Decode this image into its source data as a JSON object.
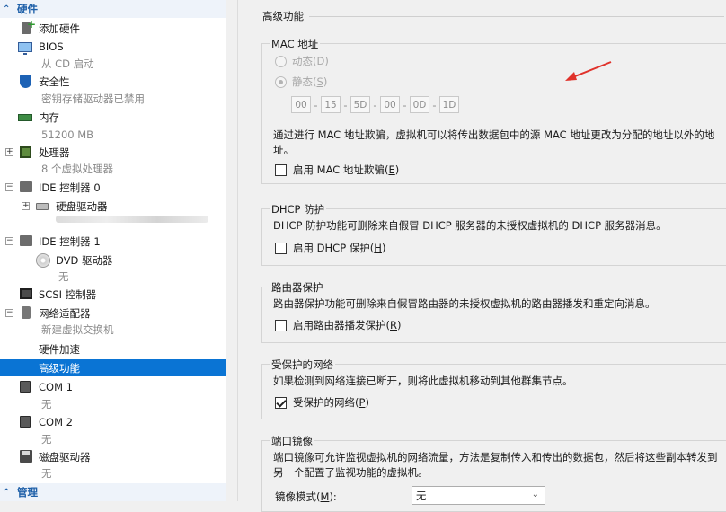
{
  "tree": {
    "hardware_header": "硬件",
    "items": {
      "add_hardware": "添加硬件",
      "bios": "BIOS",
      "bios_sub": "从 CD 启动",
      "security": "安全性",
      "security_sub": "密钥存储驱动器已禁用",
      "memory": "内存",
      "memory_sub": "51200 MB",
      "processor": "处理器",
      "processor_sub": "8 个虚拟处理器",
      "ide0": "IDE 控制器 0",
      "hard_drive": "硬盘驱动器",
      "ide1": "IDE 控制器 1",
      "dvd": "DVD 驱动器",
      "dvd_sub": "无",
      "scsi": "SCSI 控制器",
      "network": "网络适配器",
      "network_sub": "新建虚拟交换机",
      "hw_accel": "硬件加速",
      "advanced": "高级功能",
      "com1": "COM 1",
      "com1_sub": "无",
      "com2": "COM 2",
      "com2_sub": "无",
      "floppy": "磁盘驱动器",
      "floppy_sub": "无"
    },
    "management_header": "管理",
    "expander_plus": "+",
    "expander_minus": "−",
    "chevron": "⌃"
  },
  "panel": {
    "title": "高级功能",
    "mac": {
      "legend": "MAC 地址",
      "dynamic_label": "动态",
      "dynamic_key": "D",
      "static_label": "静态",
      "static_key": "S",
      "octets": [
        "00",
        "15",
        "5D",
        "00",
        "0D",
        "1D"
      ],
      "separator": "-",
      "description_1": "通过进行 MAC 地址欺骗，虚拟机可以将传出数据包中的源 MAC 地址更改为分配的地址以外的地",
      "description_2": "址。",
      "spoof_label": "启用 MAC 地址欺骗",
      "spoof_key": "E",
      "spoof_checked": false
    },
    "dhcp": {
      "legend": "DHCP 防护",
      "description": "DHCP 防护功能可删除来自假冒 DHCP 服务器的未授权虚拟机的 DHCP 服务器消息。",
      "label": "启用 DHCP 保护",
      "key": "H",
      "checked": false
    },
    "router": {
      "legend": "路由器保护",
      "description": "路由器保护功能可删除来自假冒路由器的未授权虚拟机的路由器播发和重定向消息。",
      "label": "启用路由器播发保护",
      "key": "R",
      "checked": false
    },
    "protected": {
      "legend": "受保护的网络",
      "description": "如果检测到网络连接已断开，则将此虚拟机移动到其他群集节点。",
      "label": "受保护的网络",
      "key": "P",
      "checked": true
    },
    "mirror": {
      "legend": "端口镜像",
      "description_1": "端口镜像可允许监视虚拟机的网络流量，方法是复制传入和传出的数据包，然后将这些副本转发到",
      "description_2": "另一个配置了监视功能的虚拟机。",
      "mode_label": "镜像模式",
      "mode_key": "M",
      "mode_value": "无"
    }
  },
  "colors": {
    "selection": "#0a74d4",
    "header_text": "#1d5fa8",
    "arrow": "#e0322b"
  }
}
